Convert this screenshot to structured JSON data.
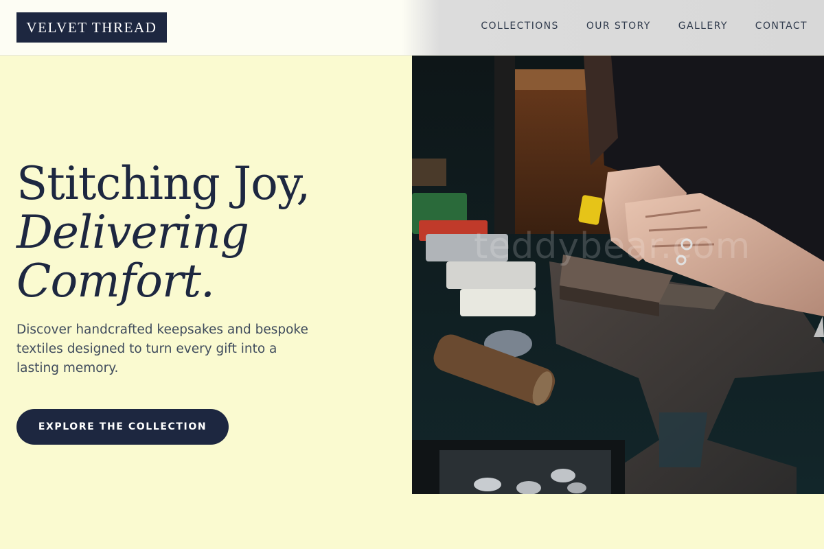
{
  "brand": {
    "logo_text": "VELVET THREAD"
  },
  "nav": {
    "items": [
      {
        "label": "COLLECTIONS"
      },
      {
        "label": "OUR STORY"
      },
      {
        "label": "GALLERY"
      },
      {
        "label": "CONTACT"
      }
    ]
  },
  "hero": {
    "headline_line1": "Stitching Joy,",
    "headline_line2": "Delivering",
    "headline_line3": "Comfort.",
    "description": "Discover handcrafted keepsakes and bespoke textiles designed to turn every gift into a lasting memory.",
    "cta_label": "EXPLORE THE COLLECTION",
    "image_watermark": "teddybear.com"
  },
  "colors": {
    "background": "#fafad0",
    "navy": "#1d2740",
    "text_muted": "#3f4b5c"
  },
  "icons": {
    "hero_image": "artisan-stamping-metal-tags-photo"
  }
}
